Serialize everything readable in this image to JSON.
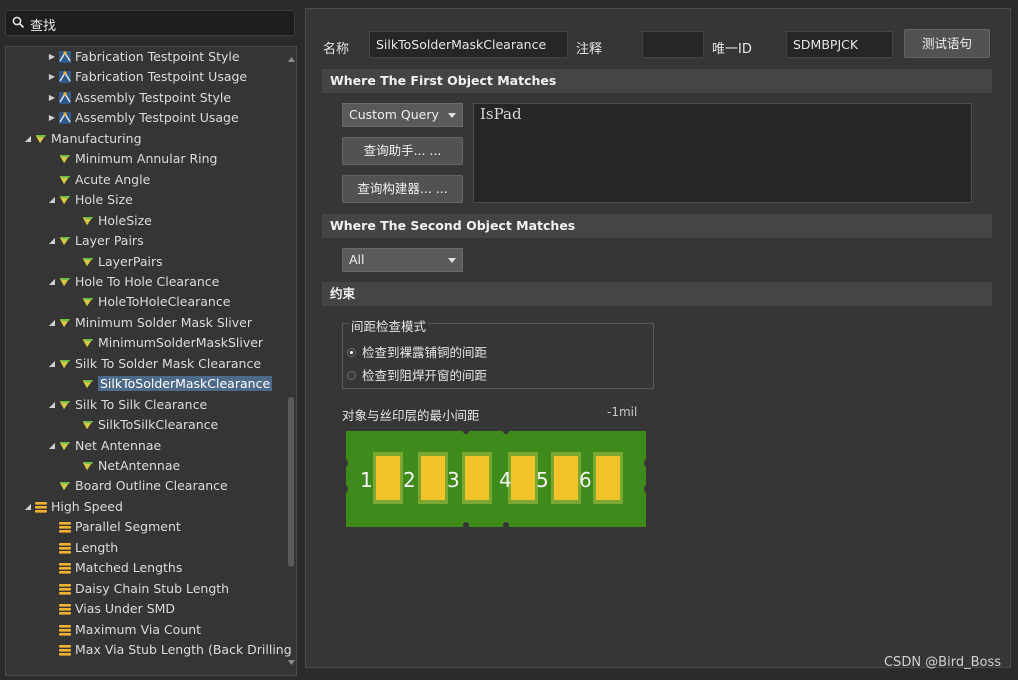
{
  "search": {
    "placeholder": "查找"
  },
  "tree": [
    {
      "level": 2,
      "arrow": "right",
      "icon": "testpoint-icon",
      "label": "Fabrication Testpoint Style"
    },
    {
      "level": 2,
      "arrow": "right",
      "icon": "testpoint-icon",
      "label": "Fabrication Testpoint Usage"
    },
    {
      "level": 2,
      "arrow": "right",
      "icon": "testpoint-icon",
      "label": "Assembly Testpoint Style"
    },
    {
      "level": 2,
      "arrow": "right",
      "icon": "testpoint-icon",
      "label": "Assembly Testpoint Usage"
    },
    {
      "level": 1,
      "arrow": "down",
      "icon": "manufacturing-icon",
      "label": "Manufacturing"
    },
    {
      "level": 2,
      "arrow": "",
      "icon": "manufacturing-icon",
      "label": "Minimum Annular Ring"
    },
    {
      "level": 2,
      "arrow": "",
      "icon": "manufacturing-icon",
      "label": "Acute Angle"
    },
    {
      "level": 2,
      "arrow": "down",
      "icon": "manufacturing-icon",
      "label": "Hole Size"
    },
    {
      "level": 3,
      "arrow": "",
      "icon": "manufacturing-icon",
      "label": "HoleSize"
    },
    {
      "level": 2,
      "arrow": "down",
      "icon": "manufacturing-icon",
      "label": "Layer Pairs"
    },
    {
      "level": 3,
      "arrow": "",
      "icon": "manufacturing-icon",
      "label": "LayerPairs"
    },
    {
      "level": 2,
      "arrow": "down",
      "icon": "manufacturing-icon",
      "label": "Hole To Hole Clearance"
    },
    {
      "level": 3,
      "arrow": "",
      "icon": "manufacturing-icon",
      "label": "HoleToHoleClearance"
    },
    {
      "level": 2,
      "arrow": "down",
      "icon": "manufacturing-icon",
      "label": "Minimum Solder Mask Sliver"
    },
    {
      "level": 3,
      "arrow": "",
      "icon": "manufacturing-icon",
      "label": "MinimumSolderMaskSliver"
    },
    {
      "level": 2,
      "arrow": "down",
      "icon": "manufacturing-icon",
      "label": "Silk To Solder Mask Clearance"
    },
    {
      "level": 3,
      "arrow": "",
      "icon": "manufacturing-icon",
      "label": "SilkToSolderMaskClearance",
      "selected": true
    },
    {
      "level": 2,
      "arrow": "down",
      "icon": "manufacturing-icon",
      "label": "Silk To Silk Clearance"
    },
    {
      "level": 3,
      "arrow": "",
      "icon": "manufacturing-icon",
      "label": "SilkToSilkClearance"
    },
    {
      "level": 2,
      "arrow": "down",
      "icon": "manufacturing-icon",
      "label": "Net Antennae"
    },
    {
      "level": 3,
      "arrow": "",
      "icon": "manufacturing-icon",
      "label": "NetAntennae"
    },
    {
      "level": 2,
      "arrow": "",
      "icon": "manufacturing-icon",
      "label": "Board Outline Clearance"
    },
    {
      "level": 1,
      "arrow": "down",
      "icon": "high-speed-icon",
      "label": "High Speed"
    },
    {
      "level": 2,
      "arrow": "",
      "icon": "high-speed-icon",
      "label": "Parallel Segment"
    },
    {
      "level": 2,
      "arrow": "",
      "icon": "high-speed-icon",
      "label": "Length"
    },
    {
      "level": 2,
      "arrow": "",
      "icon": "high-speed-icon",
      "label": "Matched Lengths"
    },
    {
      "level": 2,
      "arrow": "",
      "icon": "high-speed-icon",
      "label": "Daisy Chain Stub Length"
    },
    {
      "level": 2,
      "arrow": "",
      "icon": "high-speed-icon",
      "label": "Vias Under SMD"
    },
    {
      "level": 2,
      "arrow": "",
      "icon": "high-speed-icon",
      "label": "Maximum Via Count"
    },
    {
      "level": 2,
      "arrow": "",
      "icon": "high-speed-icon",
      "label": "Max Via Stub Length (Back Drilling"
    }
  ],
  "header": {
    "name_label": "名称",
    "name_value": "SilkToSolderMaskClearance",
    "comment_label": "注释",
    "comment_value": "",
    "id_label": "唯一ID",
    "id_value": "SDMBPJCK",
    "test_button": "测试语句"
  },
  "first_match": {
    "title": "Where The First Object Matches",
    "mode": "Custom Query",
    "query_helper_button": "查询助手... ...",
    "query_builder_button": "查询构建器... ...",
    "query_text": "IsPad"
  },
  "second_match": {
    "title": "Where The Second Object Matches",
    "mode": "All"
  },
  "constraints": {
    "title": "约束",
    "group_title": "间距检查模式",
    "options": [
      {
        "label": "检查到裸露铺铜的间距",
        "checked": true
      },
      {
        "label": "检查到阻焊开窗的间距",
        "checked": false
      }
    ],
    "min_clearance_label": "对象与丝印层的最小间距",
    "min_clearance_value": "-1mil",
    "pads": [
      "1",
      "2",
      "3",
      "4",
      "5",
      "6"
    ]
  },
  "colors": {
    "pcb_green": "#3e8a1a",
    "pad_yellow": "#f2c42a",
    "selection": "#4e6a8a"
  },
  "watermark": "CSDN @Bird_Boss"
}
